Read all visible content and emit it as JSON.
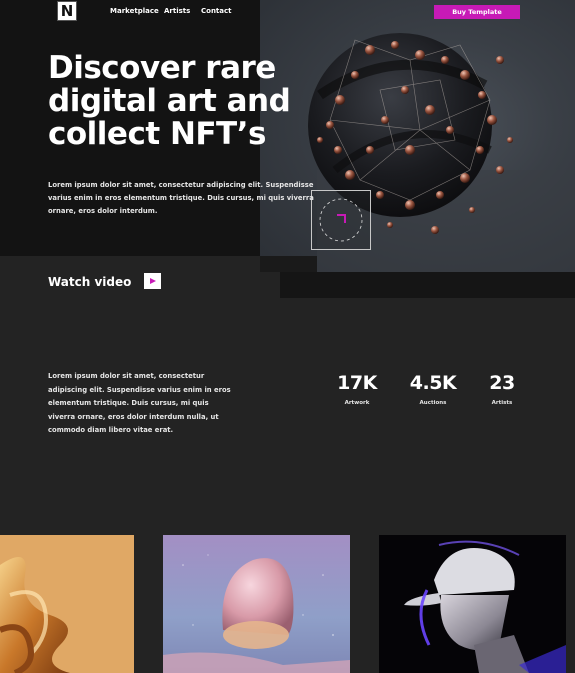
{
  "nav": {
    "logo_letter": "N",
    "links": [
      "Marketplace",
      "Artists",
      "Contact"
    ],
    "buy_label": "Buy Template"
  },
  "hero": {
    "title": "Discover rare digital art and collect NFT’s",
    "intro": "Lorem ipsum dolor sit amet, consectetur adipiscing elit. Suspendisse varius enim in eros elementum tristique. Duis cursus, mi quis viverra ornare, eros dolor interdum.",
    "watch_label": "Watch video"
  },
  "about": {
    "text": "Lorem ipsum dolor sit amet, consectetur adipiscing elit. Suspendisse varius enim in eros elementum tristique. Duis cursus, mi quis viverra ornare, eros dolor interdum nulla, ut commodo diam libero vitae erat."
  },
  "stats": [
    {
      "value": "17K",
      "label": "Artwork"
    },
    {
      "value": "4.5K",
      "label": "Auctions"
    },
    {
      "value": "23",
      "label": "Artists"
    }
  ],
  "colors": {
    "accent": "#c71ab6",
    "background": "#232323",
    "hero_background": "#131313"
  },
  "icons": {
    "play": "play-icon"
  }
}
